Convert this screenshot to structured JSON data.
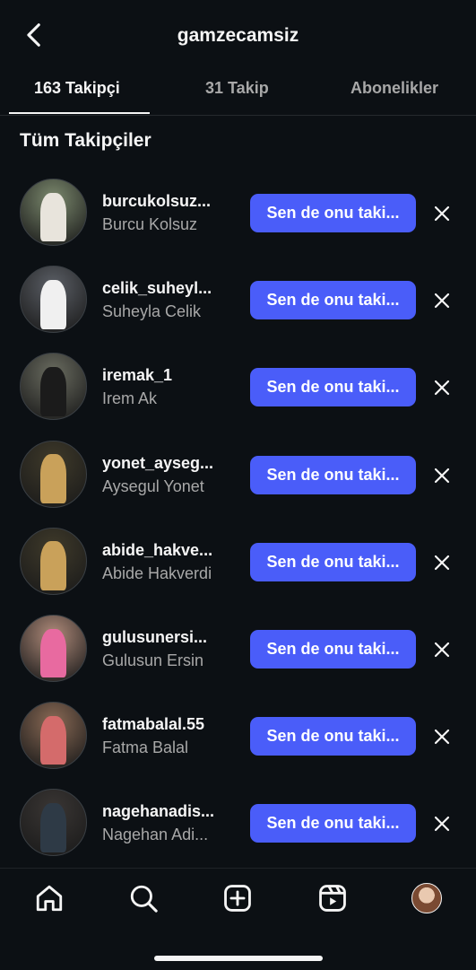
{
  "header": {
    "title": "gamzecamsiz",
    "back_icon": "chevron-left-icon"
  },
  "tabs": [
    {
      "label": "163 Takipçi",
      "active": true
    },
    {
      "label": "31 Takip",
      "active": false
    },
    {
      "label": "Abonelikler",
      "active": false
    }
  ],
  "section_title": "Tüm Takipçiler",
  "followers": [
    {
      "username": "burcukolsuz...",
      "name": "Burcu Kolsuz",
      "button": "Sen de onu taki..."
    },
    {
      "username": "celik_suheyl...",
      "name": "Suheyla Celik",
      "button": "Sen de onu taki..."
    },
    {
      "username": "iremak_1",
      "name": "Irem Ak",
      "button": "Sen de onu taki..."
    },
    {
      "username": "yonet_ayseg...",
      "name": "Aysegul Yonet",
      "button": "Sen de onu taki..."
    },
    {
      "username": "abide_hakve...",
      "name": "Abide Hakverdi",
      "button": "Sen de onu taki..."
    },
    {
      "username": "gulusunersi...",
      "name": "Gulusun Ersin",
      "button": "Sen de onu taki..."
    },
    {
      "username": "fatmabalal.55",
      "name": "Fatma Balal",
      "button": "Sen de onu taki..."
    },
    {
      "username": "nagehanadis...",
      "name": "Nagehan Adi...",
      "button": "Sen de onu taki..."
    }
  ],
  "avatar_colors": [
    [
      "#7c8a6e",
      "#e8e4dc"
    ],
    [
      "#5b5f66",
      "#f0f0f0"
    ],
    [
      "#6a6c60",
      "#1b1b1b"
    ],
    [
      "#3f3a2a",
      "#c9a15a"
    ],
    [
      "#3f3a2a",
      "#c9a15a"
    ],
    [
      "#b08b7a",
      "#e86aa0"
    ],
    [
      "#8a6a55",
      "#d46b6b"
    ],
    [
      "#3a3634",
      "#2e3a46"
    ]
  ],
  "bottom_nav": [
    "home-icon",
    "search-icon",
    "create-icon",
    "reels-icon",
    "profile-avatar"
  ],
  "colors": {
    "background": "#0c1014",
    "primary_button": "#4a5df9",
    "secondary_text": "#a8a8a8"
  }
}
